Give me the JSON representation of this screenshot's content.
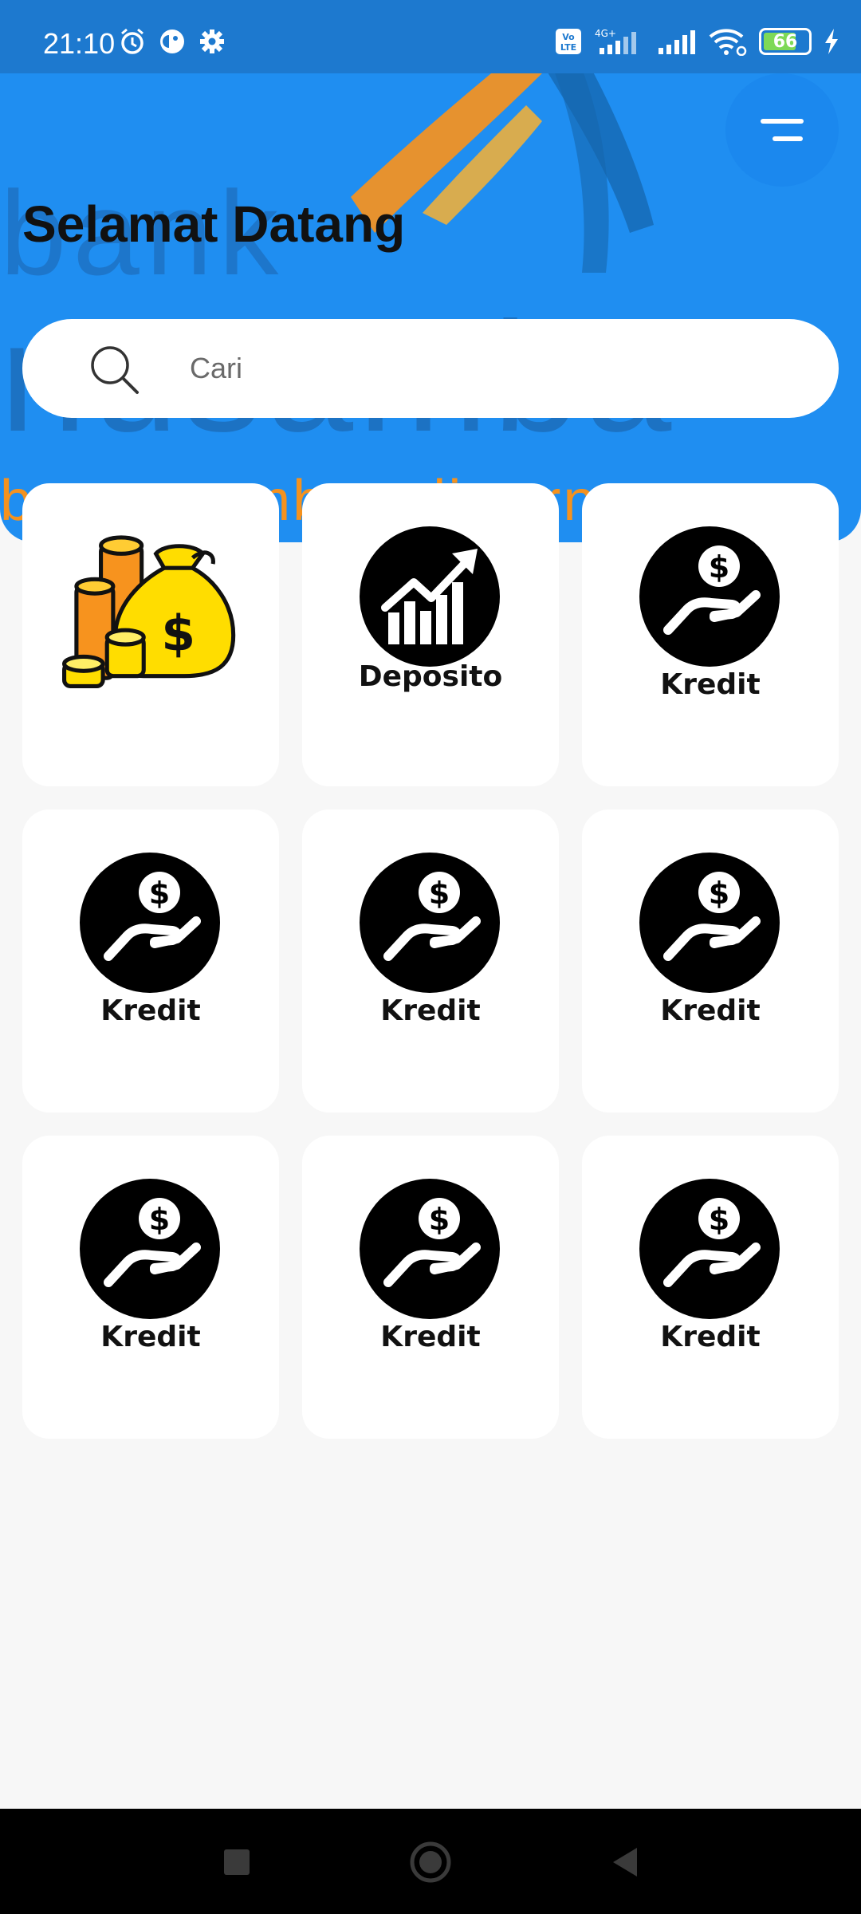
{
  "status_bar": {
    "time": "21:10",
    "network": "4G+",
    "volte": "Vo LTE",
    "battery": "66"
  },
  "header": {
    "title": "Selamat Datang",
    "watermark_line1": "bank",
    "watermark_line2": "nusamba",
    "watermark_line3": "bpr nusamba adiwerna"
  },
  "search": {
    "placeholder": "Cari",
    "value": ""
  },
  "menu": [
    {
      "label": "",
      "icon": "money-bag-icon"
    },
    {
      "label": "Deposito",
      "icon": "chart-growth-icon"
    },
    {
      "label": "Kredit",
      "icon": "hand-coin-icon"
    },
    {
      "label": "Kredit",
      "icon": "hand-coin-icon"
    },
    {
      "label": "Kredit",
      "icon": "hand-coin-icon"
    },
    {
      "label": "Kredit",
      "icon": "hand-coin-icon"
    },
    {
      "label": "Kredit",
      "icon": "hand-coin-icon"
    },
    {
      "label": "Kredit",
      "icon": "hand-coin-icon"
    },
    {
      "label": "Kredit",
      "icon": "hand-coin-icon"
    }
  ],
  "colors": {
    "header_blue": "#1f8ef1",
    "status_blue": "#1d79cf",
    "accent_orange": "#f5921e",
    "background": "#f7f7f7"
  }
}
